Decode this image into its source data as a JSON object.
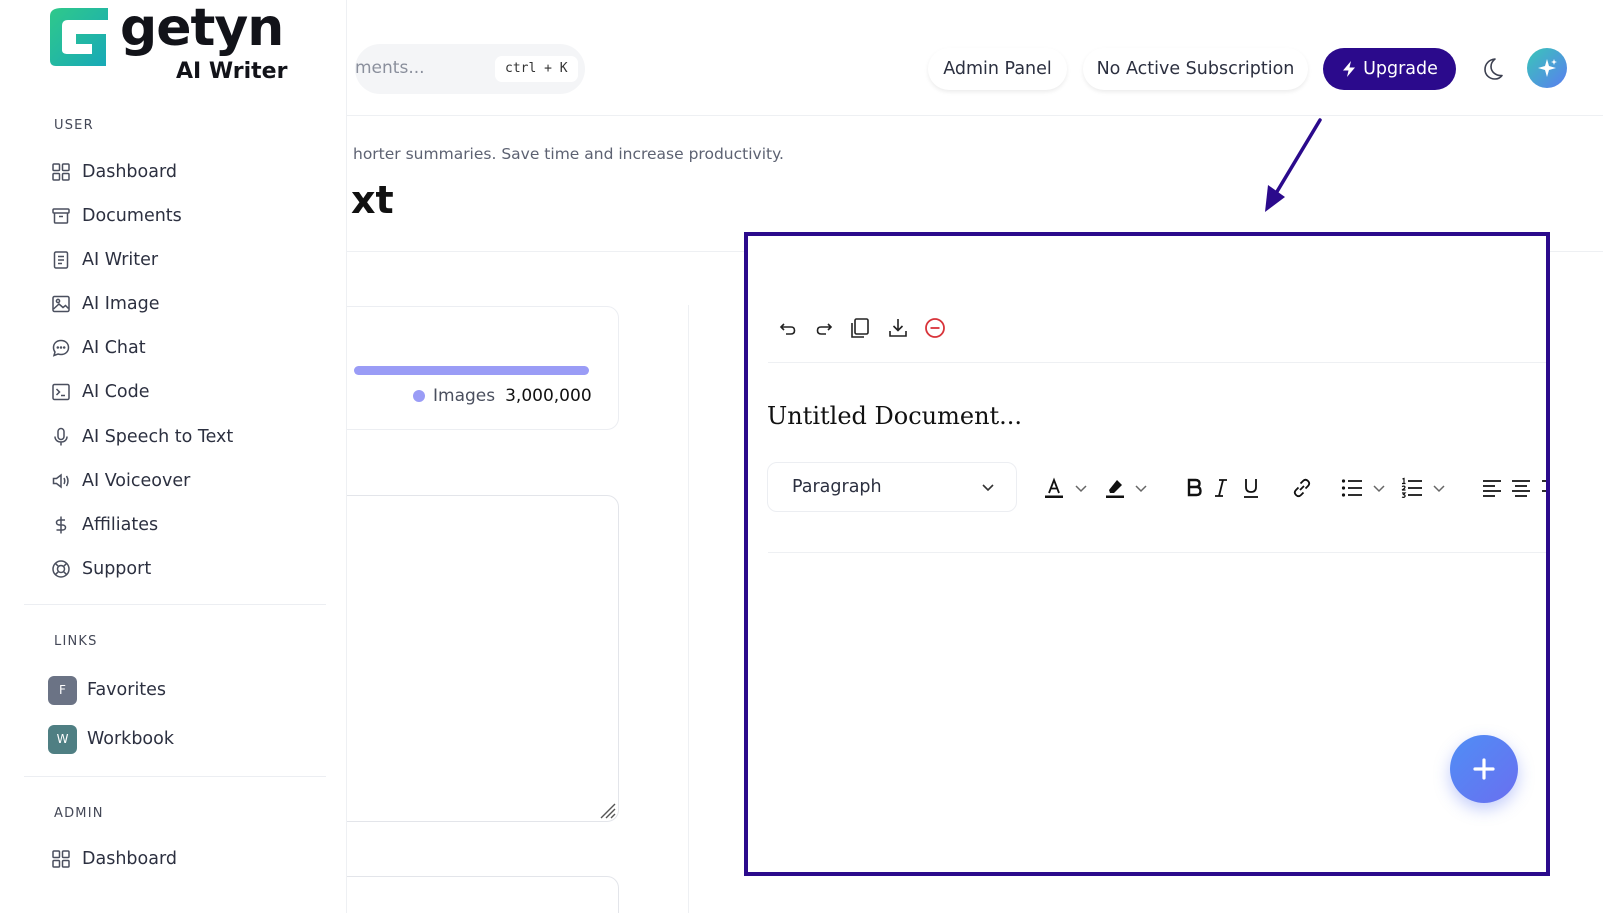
{
  "brand": {
    "name": "getyn",
    "product": "AI Writer",
    "accent": "#2b0a8c"
  },
  "sidebar": {
    "user_section": "USER",
    "user_items": [
      {
        "label": "Dashboard",
        "icon": "grid-icon"
      },
      {
        "label": "Documents",
        "icon": "archive-icon"
      },
      {
        "label": "AI Writer",
        "icon": "file-text-icon"
      },
      {
        "label": "AI Image",
        "icon": "image-icon"
      },
      {
        "label": "AI Chat",
        "icon": "chat-icon"
      },
      {
        "label": "AI Code",
        "icon": "terminal-icon"
      },
      {
        "label": "AI Speech to Text",
        "icon": "microphone-icon"
      },
      {
        "label": "AI Voiceover",
        "icon": "speaker-icon"
      },
      {
        "label": "Affiliates",
        "icon": "dollar-icon"
      },
      {
        "label": "Support",
        "icon": "lifebuoy-icon"
      }
    ],
    "links_section": "LINKS",
    "links": [
      {
        "badge": "F",
        "label": "Favorites",
        "color": "#6b7385"
      },
      {
        "badge": "W",
        "label": "Workbook",
        "color": "#4f7f83"
      }
    ],
    "admin_section": "ADMIN",
    "admin_items": [
      {
        "label": "Dashboard",
        "icon": "grid-icon"
      }
    ]
  },
  "header": {
    "search_placeholder": "ments...",
    "search_shortcut": "ctrl + K",
    "admin_panel": "Admin Panel",
    "subscription": "No Active Subscription",
    "upgrade": "Upgrade"
  },
  "main": {
    "description": "horter summaries. Save time and increase productivity.",
    "title": "xt",
    "usage": {
      "label": "Images",
      "value": "3,000,000",
      "color": "#9a9cf6"
    }
  },
  "editor": {
    "doc_title": "Untitled Document...",
    "block_type": "Paragraph"
  }
}
